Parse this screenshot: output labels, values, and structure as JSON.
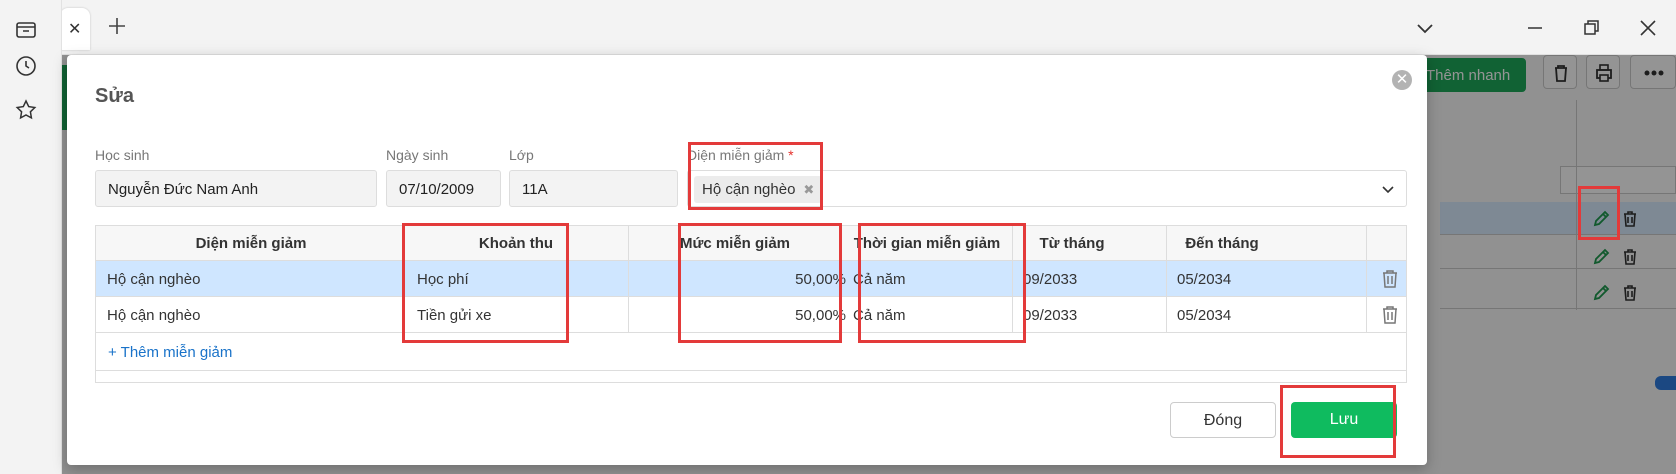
{
  "dialog": {
    "title": "Sửa",
    "close_symbol": "✕"
  },
  "form": {
    "student_label": "Học sinh",
    "student_value": "Nguyễn Đức Nam Anh",
    "dob_label": "Ngày sinh",
    "dob_value": "07/10/2009",
    "class_label": "Lớp",
    "class_value": "11A",
    "exemption_label": "Diện miễn giảm",
    "required_mark": "*",
    "exemption_chip": "Hộ cận nghèo",
    "chip_remove": "✖"
  },
  "table": {
    "headers": [
      "Diện miễn giảm",
      "Khoản thu",
      "Mức miễn giảm",
      "Thời gian miễn giảm",
      "Từ tháng",
      "Đến tháng"
    ],
    "rows": [
      {
        "category": "Hộ cận nghèo",
        "fee": "Học phí",
        "rate": "50,00%",
        "period": "Cả năm",
        "from": "09/2033",
        "to": "05/2034",
        "selected": true
      },
      {
        "category": "Hộ cận nghèo",
        "fee": "Tiền gửi xe",
        "rate": "50,00%",
        "period": "Cả năm",
        "from": "09/2033",
        "to": "05/2034",
        "selected": false
      }
    ],
    "add_link": "+ Thêm miễn giảm"
  },
  "buttons": {
    "close": "Đóng",
    "save": "Lưu"
  },
  "background": {
    "quick_add": "Thêm nhanh"
  },
  "colors": {
    "save_green": "#0fbb5f",
    "highlight_red": "#e33a3a",
    "selected_row": "#cfe6ff",
    "link_blue": "#1a73c9"
  }
}
